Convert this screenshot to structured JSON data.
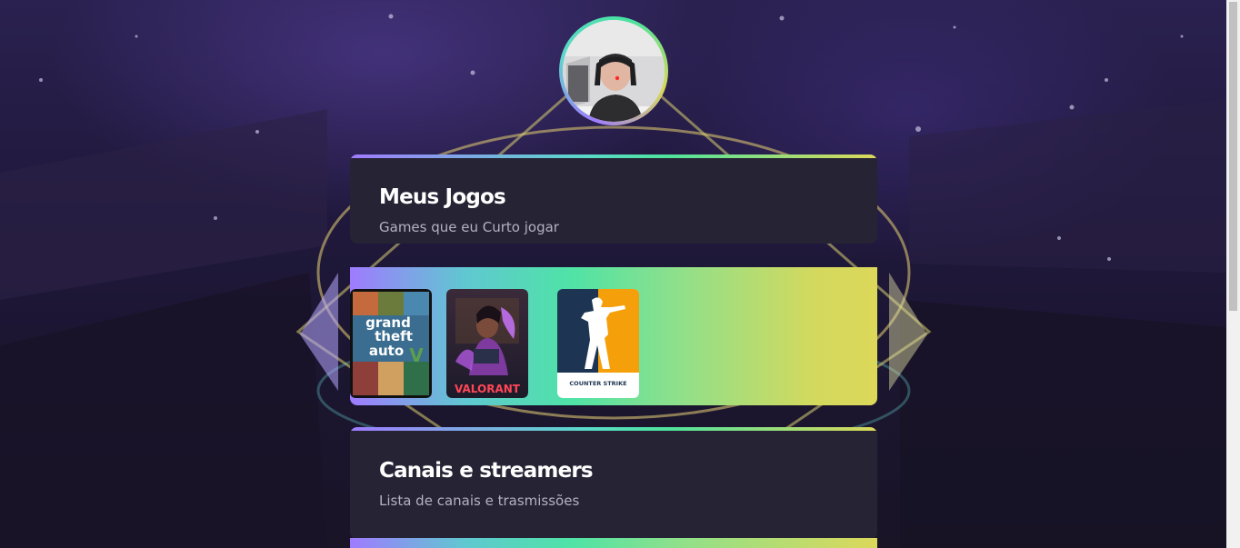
{
  "profile": {
    "avatar_icon": "profile-photo-icon"
  },
  "games_card": {
    "title": "Meus Jogos",
    "subtitle": "Games que eu Curto jogar"
  },
  "games": [
    {
      "name": "grand theft auto",
      "icon": "gta-v-cover-icon"
    },
    {
      "name": "VALORANT",
      "icon": "valorant-cover-icon"
    },
    {
      "name": "COUNTER STRIKE",
      "icon": "counter-strike-cover-icon"
    }
  ],
  "channels_card": {
    "title": "Canais e streamers",
    "subtitle": "Lista de canais e trasmissões"
  },
  "colors": {
    "card_bg": "#262334",
    "gradient_start": "#9f7bff",
    "gradient_mid": "#4fe3a6",
    "gradient_end": "#dcd85a",
    "page_bg": "#1e1832"
  }
}
